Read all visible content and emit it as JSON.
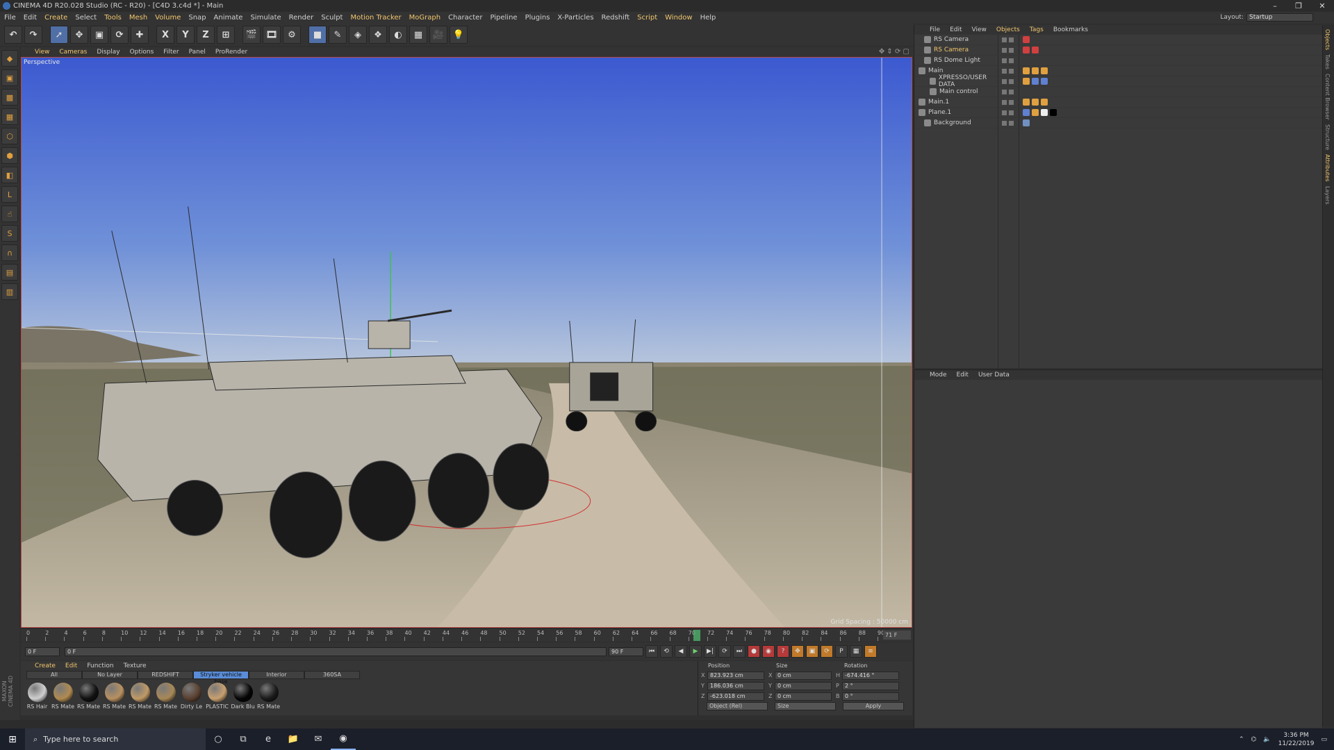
{
  "window": {
    "title": "CINEMA 4D R20.028 Studio (RC - R20) - [C4D 3.c4d *] - Main"
  },
  "menu": [
    "File",
    "Edit",
    "Create",
    "Select",
    "Tools",
    "Mesh",
    "Volume",
    "Snap",
    "Animate",
    "Simulate",
    "Render",
    "Sculpt",
    "Motion Tracker",
    "MoGraph",
    "Character",
    "Pipeline",
    "Plugins",
    "X-Particles",
    "Redshift",
    "Script",
    "Window",
    "Help"
  ],
  "layout": {
    "label": "Layout:",
    "value": "Startup"
  },
  "toolbar": {
    "x_axis": "X",
    "y_axis": "Y",
    "z_axis": "Z"
  },
  "viewport_menu": [
    "View",
    "Cameras",
    "Display",
    "Options",
    "Filter",
    "Panel",
    "ProRender"
  ],
  "viewport": {
    "label": "Perspective",
    "grid_spacing": "Grid Spacing : 50000 cm"
  },
  "object_manager": {
    "menu": [
      "File",
      "Edit",
      "View",
      "Objects",
      "Tags",
      "Bookmarks"
    ],
    "objects": [
      {
        "name": "RS Camera",
        "selected": false
      },
      {
        "name": "RS Camera",
        "selected": true
      },
      {
        "name": "RS Dome Light",
        "selected": false
      },
      {
        "name": "Main",
        "selected": false
      },
      {
        "name": "XPRESSO/USER DATA",
        "selected": false
      },
      {
        "name": "Main control",
        "selected": false
      },
      {
        "name": "Main.1",
        "selected": false
      },
      {
        "name": "Plane.1",
        "selected": false
      },
      {
        "name": "Background",
        "selected": false
      }
    ]
  },
  "attribute_manager": {
    "menu": [
      "Mode",
      "Edit",
      "User Data"
    ]
  },
  "right_tabs": [
    "Objects",
    "Takes",
    "Content Browser",
    "Structure",
    "Attributes",
    "Layers"
  ],
  "timeline": {
    "ticks": [
      "0",
      "2",
      "4",
      "6",
      "8",
      "10",
      "12",
      "14",
      "16",
      "18",
      "20",
      "22",
      "24",
      "26",
      "28",
      "30",
      "32",
      "34",
      "36",
      "38",
      "40",
      "42",
      "44",
      "46",
      "48",
      "50",
      "52",
      "54",
      "56",
      "58",
      "60",
      "62",
      "64",
      "66",
      "68",
      "70",
      "72",
      "74",
      "76",
      "78",
      "80",
      "82",
      "84",
      "86",
      "88",
      "90"
    ],
    "current_frame": "71 F"
  },
  "transport": {
    "start": "0 F",
    "range_start": "0 F",
    "range_end": "90 F",
    "end": "90 F"
  },
  "materials": {
    "menu": [
      "Create",
      "Edit",
      "Function",
      "Texture"
    ],
    "layers": [
      "All",
      "No Layer",
      "REDSHIFT",
      "Stryker vehicle base",
      "Interior",
      "360SA"
    ],
    "items": [
      {
        "label": "RS Hair",
        "color": "#cfcfcf"
      },
      {
        "label": "RS Mate",
        "color": "#b08a50"
      },
      {
        "label": "RS Mate",
        "color": "#111111"
      },
      {
        "label": "RS Mate",
        "color": "#b89060"
      },
      {
        "label": "RS Mate",
        "color": "#c09a66"
      },
      {
        "label": "RS Mate",
        "color": "#a88858"
      },
      {
        "label": "Dirty Le",
        "color": "#5a4030"
      },
      {
        "label": "PLASTIC",
        "color": "#c8a070"
      },
      {
        "label": "Dark Blu",
        "color": "#050505"
      },
      {
        "label": "RS Mate",
        "color": "#1a1a1a"
      }
    ]
  },
  "coordinates": {
    "headers": [
      "Position",
      "Size",
      "Rotation"
    ],
    "rows": [
      {
        "p_axis": "X",
        "p": "823.923 cm",
        "s_axis": "X",
        "s": "0 cm",
        "r_axis": "H",
        "r": "-674.416 °"
      },
      {
        "p_axis": "Y",
        "p": "186.036 cm",
        "s_axis": "Y",
        "s": "0 cm",
        "r_axis": "P",
        "r": "2 °"
      },
      {
        "p_axis": "Z",
        "p": "-623.018 cm",
        "s_axis": "Z",
        "s": "0 cm",
        "r_axis": "B",
        "r": "0 °"
      }
    ],
    "mode": "Object (Rel)",
    "size_mode": "Size",
    "apply": "Apply"
  },
  "taskbar": {
    "search_placeholder": "Type here to search",
    "time": "3:36 PM",
    "date": "11/22/2019"
  }
}
